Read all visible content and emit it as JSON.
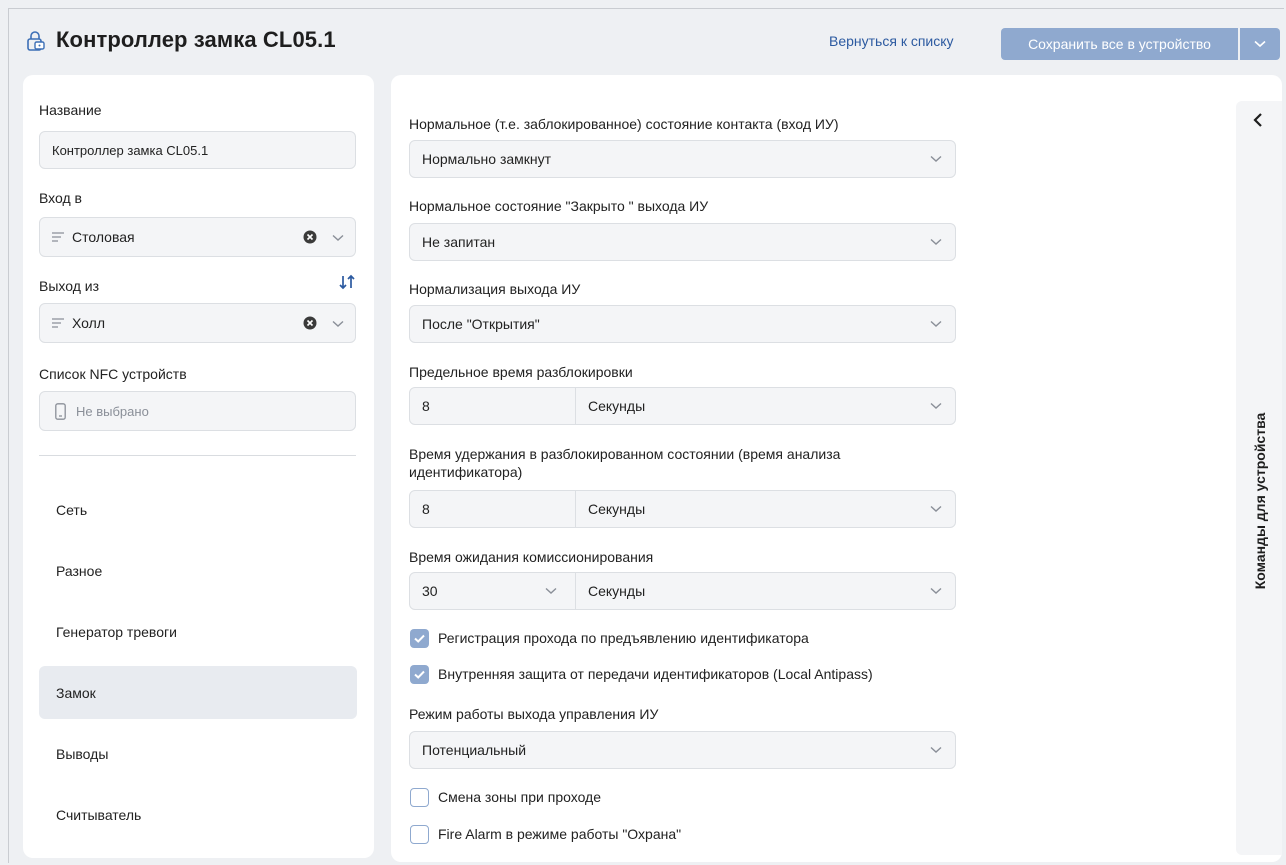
{
  "header": {
    "title": "Контроллер замка CL05.1",
    "back_label": "Вернуться к списку",
    "save_label": "Сохранить все в устройство"
  },
  "left": {
    "name_label": "Название",
    "name_value": "Контроллер замка CL05.1",
    "entry_label": "Вход в",
    "entry_value": "Столовая",
    "exit_label": "Выход из",
    "exit_value": "Холл",
    "nfc_label": "Список NFC устройств",
    "nfc_placeholder": "Не выбрано",
    "nav": [
      {
        "label": "Сеть"
      },
      {
        "label": "Разное"
      },
      {
        "label": "Генератор тревоги"
      },
      {
        "label": "Замок",
        "active": true
      },
      {
        "label": "Выводы"
      },
      {
        "label": "Считыватель"
      }
    ]
  },
  "form": {
    "contact_label": "Нормальное (т.е. заблокированное) состояние контакта (вход ИУ)",
    "contact_value": "Нормально замкнут",
    "closed_label": "Нормальное состояние \"Закрыто \" выхода ИУ",
    "closed_value": "Не запитан",
    "normalize_label": "Нормализация выхода ИУ",
    "normalize_value": "После \"Открытия\"",
    "unlock_time_label": "Предельное время разблокировки",
    "unlock_time_value": "8",
    "unlock_time_unit": "Секунды",
    "hold_label_line1": "Время удержания в разблокированном состоянии (время анализа",
    "hold_label_line2": "идентификатора)",
    "hold_value": "8",
    "hold_unit": "Секунды",
    "commission_label": "Время ожидания комиссионирования",
    "commission_value": "30",
    "commission_unit": "Секунды",
    "cb_register_label": "Регистрация прохода по предъявлению идентификатора",
    "cb_register_checked": true,
    "cb_antipass_label": "Внутренняя защита от передачи идентификаторов (Local Antipass)",
    "cb_antipass_checked": true,
    "mode_label": "Режим работы выхода управления ИУ",
    "mode_value": "Потенциальный",
    "cb_zone_label": "Смена зоны при проходе",
    "cb_zone_checked": false,
    "cb_fire_label": "Fire Alarm в режиме работы \"Охрана\"",
    "cb_fire_checked": false
  },
  "side_panel": {
    "label": "Команды для устройства"
  },
  "colors": {
    "accent": "#8fa9cf",
    "link": "#2c5aa0",
    "background": "#eef0f3",
    "field": "#f4f5f7"
  }
}
